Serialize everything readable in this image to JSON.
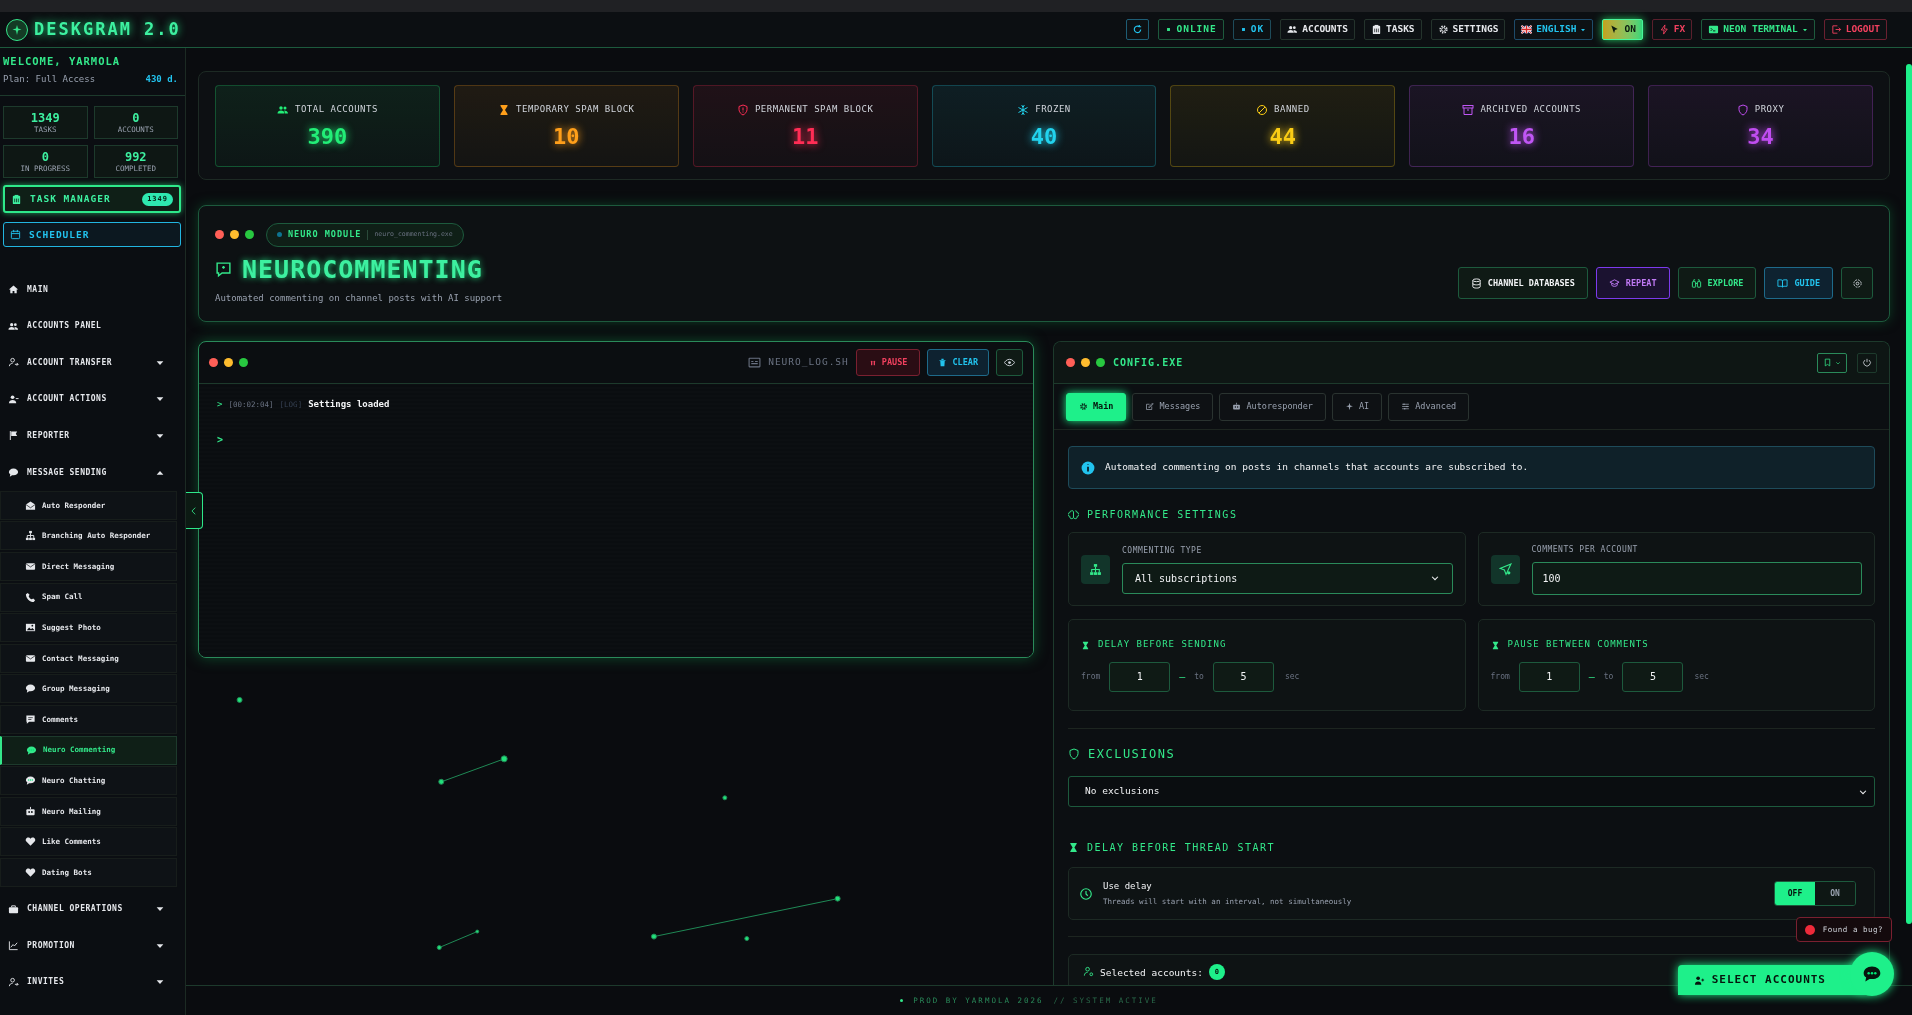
{
  "header": {
    "title": "DESKGRAM 2.0",
    "buttons": [
      {
        "kind": "refresh"
      },
      {
        "kind": "online",
        "label": "ONLINE"
      },
      {
        "kind": "ok",
        "label": "OK"
      },
      {
        "kind": "accounts",
        "label": "ACCOUNTS"
      },
      {
        "kind": "tasks",
        "label": "TASKS"
      },
      {
        "kind": "settings",
        "label": "SETTINGS"
      },
      {
        "kind": "language",
        "label": "ENGLISH"
      },
      {
        "kind": "power",
        "label": "ON"
      },
      {
        "kind": "fx",
        "label": "FX"
      },
      {
        "kind": "theme",
        "label": "NEON TERMINAL"
      },
      {
        "kind": "logout",
        "label": "LOGOUT"
      }
    ]
  },
  "sidebar": {
    "welcome": "WELCOME, YARMOLA",
    "plan": "Plan: Full Access",
    "days": "430 d.",
    "stats": [
      {
        "value": "1349",
        "label": "TASKS"
      },
      {
        "value": "0",
        "label": "ACCOUNTS"
      },
      {
        "value": "0",
        "label": "IN PROGRESS"
      },
      {
        "value": "992",
        "label": "COMPLETED"
      }
    ],
    "task_manager": {
      "label": "TASK MANAGER",
      "badge": "1349"
    },
    "scheduler": {
      "label": "SCHEDULER"
    },
    "nav": [
      {
        "label": "MAIN"
      },
      {
        "label": "ACCOUNTS PANEL"
      },
      {
        "label": "ACCOUNT TRANSFER",
        "expanded": false
      },
      {
        "label": "ACCOUNT ACTIONS",
        "expanded": false
      },
      {
        "label": "REPORTER",
        "expanded": false
      },
      {
        "label": "MESSAGE SENDING",
        "expanded": true,
        "children": [
          {
            "label": "Auto Responder",
            "selected": false
          },
          {
            "label": "Branching Auto Responder",
            "selected": false
          },
          {
            "label": "Direct Messaging",
            "selected": false
          },
          {
            "label": "Spam Call",
            "selected": false
          },
          {
            "label": "Suggest Photo",
            "selected": false
          },
          {
            "label": "Contact Messaging",
            "selected": false
          },
          {
            "label": "Group Messaging",
            "selected": false
          },
          {
            "label": "Comments",
            "selected": false
          },
          {
            "label": "Neuro Commenting",
            "selected": true
          },
          {
            "label": "Neuro Chatting",
            "selected": false
          },
          {
            "label": "Neuro Mailing",
            "selected": false
          },
          {
            "label": "Like Comments",
            "selected": false
          },
          {
            "label": "Dating Bots",
            "selected": false
          }
        ]
      },
      {
        "label": "CHANNEL OPERATIONS",
        "expanded": false
      },
      {
        "label": "PROMOTION",
        "expanded": false
      },
      {
        "label": "INVITES",
        "expanded": false
      }
    ]
  },
  "stats": [
    {
      "label": "TOTAL ACCOUNTS",
      "value": "390",
      "color": "#22ee77"
    },
    {
      "label": "TEMPORARY SPAM BLOCK",
      "value": "10",
      "color": "#ff9f1a"
    },
    {
      "label": "PERMANENT SPAM BLOCK",
      "value": "11",
      "color": "#ff2d55"
    },
    {
      "label": "FROZEN",
      "value": "40",
      "color": "#22d3ee"
    },
    {
      "label": "BANNED",
      "value": "44",
      "color": "#facc15"
    },
    {
      "label": "ARCHIVED ACCOUNTS",
      "value": "16",
      "color": "#c056f5"
    },
    {
      "label": "PROXY",
      "value": "34",
      "color": "#c04df0"
    }
  ],
  "module": {
    "badge": "NEURO MODULE",
    "file": "neuro_commenting.exe",
    "title": "NEUROCOMMENTING",
    "subtitle": "Automated commenting on channel posts with AI support",
    "actions": [
      {
        "kind": "database",
        "label": "CHANNEL DATABASES"
      },
      {
        "kind": "repeat",
        "label": "REPEAT"
      },
      {
        "kind": "explore",
        "label": "EXPLORE"
      },
      {
        "kind": "guide",
        "label": "GUIDE"
      },
      {
        "kind": "settings"
      }
    ]
  },
  "log": {
    "title": "NEURO_LOG.SH",
    "pause": "PAUSE",
    "clear": "CLEAR",
    "lines": [
      {
        "prompt": ">",
        "time": "[00:02:04]",
        "level": "[LOG]",
        "text": "Settings loaded"
      }
    ],
    "prompt": ">"
  },
  "config": {
    "title": "CONFIG.EXE",
    "tabs": [
      {
        "label": "Main",
        "selected": true
      },
      {
        "label": "Messages",
        "selected": false
      },
      {
        "label": "Autoresponder",
        "selected": false
      },
      {
        "label": "AI",
        "selected": false
      },
      {
        "label": "Advanced",
        "selected": false
      }
    ],
    "info": "Automated commenting on posts in channels that accounts are subscribed to.",
    "performance_title": "PERFORMANCE SETTINGS",
    "commenting_type": {
      "label": "COMMENTING TYPE",
      "value": "All subscriptions"
    },
    "comments_per_account": {
      "label": "COMMENTS PER ACCOUNT",
      "value": "100"
    },
    "ranges": [
      {
        "title": "DELAY BEFORE SENDING",
        "from_label": "from",
        "from": "1",
        "dash": "—",
        "to_label": "to",
        "to": "5",
        "unit": "sec"
      },
      {
        "title": "PAUSE BETWEEN COMMENTS",
        "from_label": "from",
        "from": "1",
        "dash": "—",
        "to_label": "to",
        "to": "5",
        "unit": "sec"
      }
    ],
    "exclusions": {
      "title": "EXCLUSIONS",
      "value": "No exclusions"
    },
    "thread_delay": {
      "title": "DELAY BEFORE THREAD START",
      "label": "Use delay",
      "hint": "Threads will start with an interval, not simultaneously",
      "options": [
        {
          "label": "OFF",
          "selected": true
        },
        {
          "label": "ON",
          "selected": false
        }
      ]
    },
    "selected_accounts": {
      "label": "Selected accounts:",
      "count": "0"
    }
  },
  "select_accounts_button": "SELECT ACCOUNTS",
  "bug_report": "Found a bug?",
  "footer": {
    "credit": "PROD BY YARMOLA 2026",
    "status": "// SYSTEM ACTIVE"
  }
}
